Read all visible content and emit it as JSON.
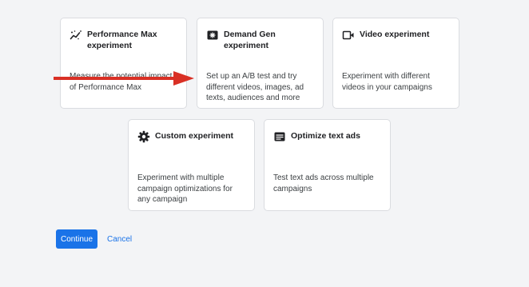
{
  "cards": [
    {
      "icon": "performance-max-icon",
      "title": "Performance Max experiment",
      "description": "Measure the potential impact of Performance Max"
    },
    {
      "icon": "demand-gen-icon",
      "title": "Demand Gen experiment",
      "description": "Set up an A/B test and try different videos, images, ad texts, audiences and more"
    },
    {
      "icon": "video-camera-icon",
      "title": "Video experiment",
      "description": "Experiment with different videos in your campaigns"
    },
    {
      "icon": "gear-icon",
      "title": "Custom experiment",
      "description": "Experiment with multiple campaign optimizations for any campaign"
    },
    {
      "icon": "text-ads-icon",
      "title": "Optimize text ads",
      "description": "Test text ads across multiple campaigns"
    }
  ],
  "actions": {
    "continue_label": "Continue",
    "cancel_label": "Cancel"
  },
  "colors": {
    "accent": "#1a73e8",
    "arrow": "#d93025",
    "background": "#f3f4f6",
    "card_border": "#dadce0"
  }
}
